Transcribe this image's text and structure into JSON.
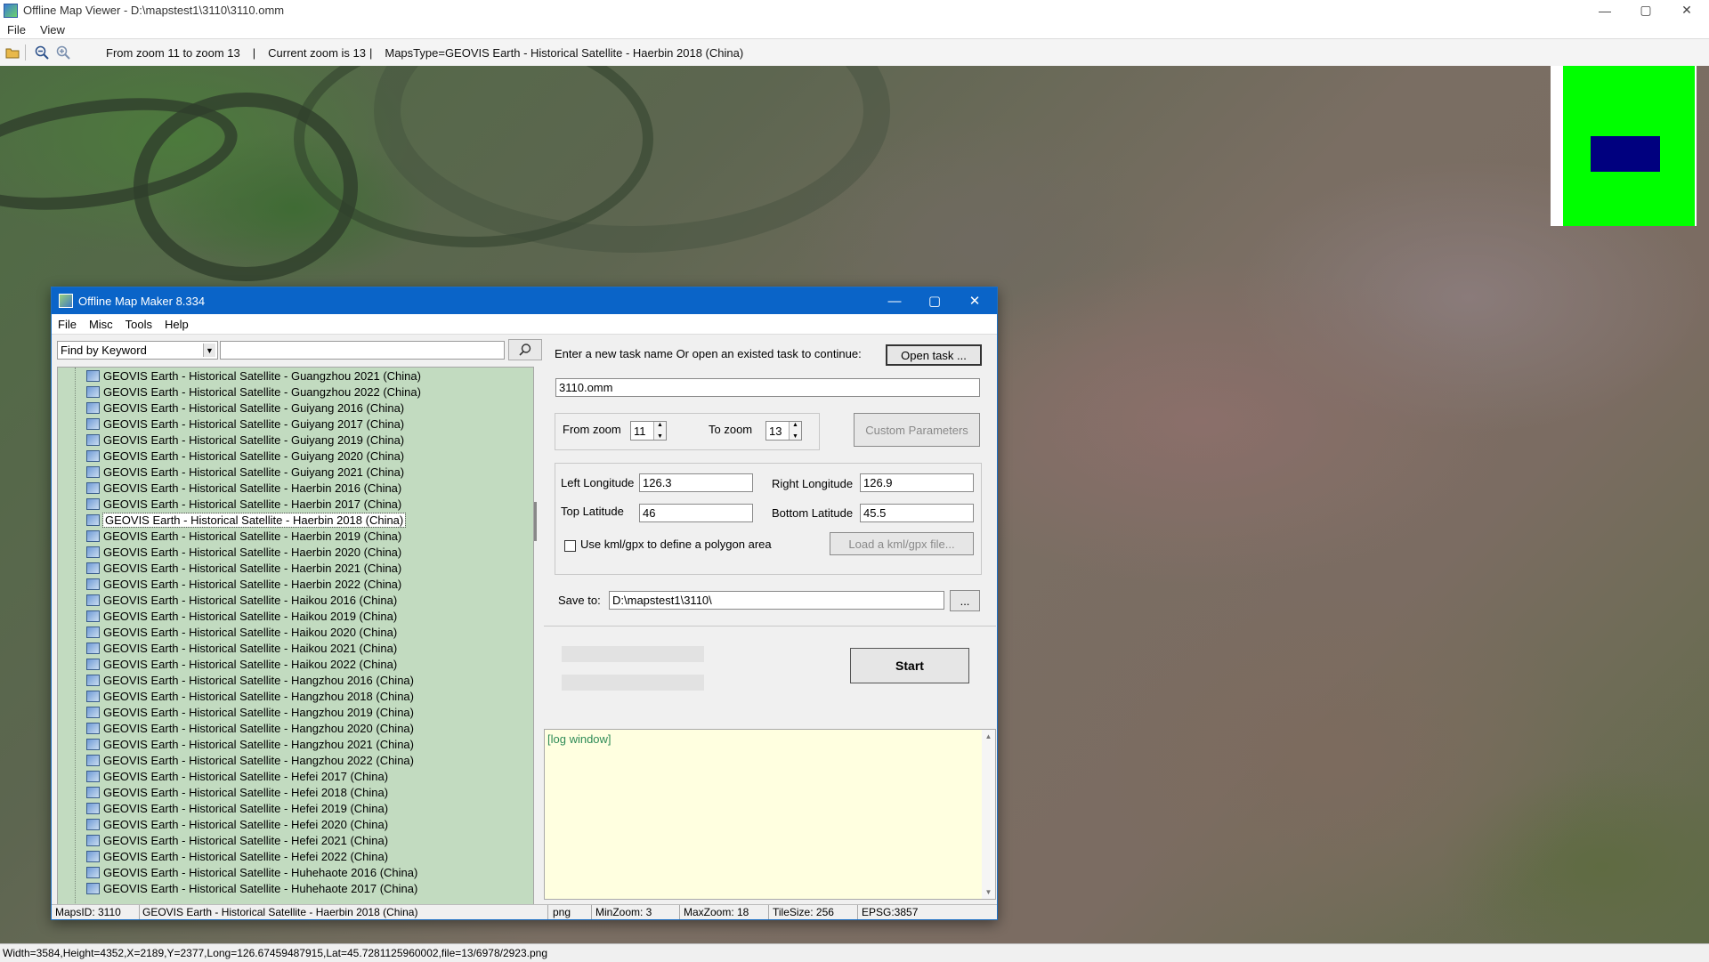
{
  "window": {
    "title": "Offline Map Viewer - D:\\mapstest1\\3110\\3110.omm",
    "minimize": "—",
    "maximize": "▢",
    "close": "✕"
  },
  "menu": {
    "file": "File",
    "view": "View"
  },
  "toolbar": {
    "zoom_range": "From zoom 11 to zoom 13",
    "current_zoom": "Current zoom is 13",
    "maps_type": "MapsType=GEOVIS Earth - Historical Satellite - Haerbin 2018 (China)",
    "sep": "|"
  },
  "status_bar": "Width=3584,Height=4352,X=2189,Y=2377,Long=126.67459487915,Lat=45.7281125960002,file=13/6978/2923.png",
  "minimap": {
    "bg_color": "#00ff00",
    "view_color": "#00007f"
  },
  "dialog": {
    "title": "Offline Map Maker 8.334",
    "menu": [
      "File",
      "Misc",
      "Tools",
      "Help"
    ],
    "find_mode": "Find by Keyword",
    "find_query": "",
    "list": [
      "GEOVIS Earth - Historical Satellite - Guangzhou 2021 (China)",
      "GEOVIS Earth - Historical Satellite - Guangzhou 2022 (China)",
      "GEOVIS Earth - Historical Satellite - Guiyang 2016 (China)",
      "GEOVIS Earth - Historical Satellite - Guiyang 2017 (China)",
      "GEOVIS Earth - Historical Satellite - Guiyang 2019 (China)",
      "GEOVIS Earth - Historical Satellite - Guiyang 2020 (China)",
      "GEOVIS Earth - Historical Satellite - Guiyang 2021 (China)",
      "GEOVIS Earth - Historical Satellite - Haerbin 2016 (China)",
      "GEOVIS Earth - Historical Satellite - Haerbin 2017 (China)",
      "GEOVIS Earth - Historical Satellite - Haerbin 2018 (China)",
      "GEOVIS Earth - Historical Satellite - Haerbin 2019 (China)",
      "GEOVIS Earth - Historical Satellite - Haerbin 2020 (China)",
      "GEOVIS Earth - Historical Satellite - Haerbin 2021 (China)",
      "GEOVIS Earth - Historical Satellite - Haerbin 2022 (China)",
      "GEOVIS Earth - Historical Satellite - Haikou 2016 (China)",
      "GEOVIS Earth - Historical Satellite - Haikou 2019 (China)",
      "GEOVIS Earth - Historical Satellite - Haikou 2020 (China)",
      "GEOVIS Earth - Historical Satellite - Haikou 2021 (China)",
      "GEOVIS Earth - Historical Satellite - Haikou 2022 (China)",
      "GEOVIS Earth - Historical Satellite - Hangzhou 2016 (China)",
      "GEOVIS Earth - Historical Satellite - Hangzhou 2018 (China)",
      "GEOVIS Earth - Historical Satellite - Hangzhou 2019 (China)",
      "GEOVIS Earth - Historical Satellite - Hangzhou 2020 (China)",
      "GEOVIS Earth - Historical Satellite - Hangzhou 2021 (China)",
      "GEOVIS Earth - Historical Satellite - Hangzhou 2022 (China)",
      "GEOVIS Earth - Historical Satellite - Hefei 2017 (China)",
      "GEOVIS Earth - Historical Satellite - Hefei 2018 (China)",
      "GEOVIS Earth - Historical Satellite - Hefei 2019 (China)",
      "GEOVIS Earth - Historical Satellite - Hefei 2020 (China)",
      "GEOVIS Earth - Historical Satellite - Hefei 2021 (China)",
      "GEOVIS Earth - Historical Satellite - Hefei 2022 (China)",
      "GEOVIS Earth - Historical Satellite - Huhehaote 2016 (China)",
      "GEOVIS Earth - Historical Satellite - Huhehaote 2017 (China)"
    ],
    "selected_item": "GEOVIS Earth - Historical Satellite - Haerbin 2018 (China)",
    "task_prompt": "Enter a new task name Or open an existed task to continue:",
    "open_task": "Open task ...",
    "task_name": "3110.omm",
    "from_zoom_label": "From zoom",
    "from_zoom": "11",
    "to_zoom_label": "To zoom",
    "to_zoom": "13",
    "custom_params": "Custom Parameters",
    "left_lon_label": "Left Longitude",
    "left_lon": "126.3",
    "right_lon_label": "Right Longitude",
    "right_lon": "126.9",
    "top_lat_label": "Top Latitude",
    "top_lat": "46",
    "bottom_lat_label": "Bottom Latitude",
    "bottom_lat": "45.5",
    "kml_checkbox": "Use kml/gpx to define a polygon area",
    "kml_checked": false,
    "load_kml": "Load a kml/gpx file...",
    "save_to_label": "Save to:",
    "save_to": "D:\\mapstest1\\3110\\",
    "browse": "...",
    "start": "Start",
    "log": "[log window]",
    "status": {
      "maps_id": "MapsID: 3110",
      "name": "GEOVIS Earth - Historical Satellite - Haerbin 2018 (China)",
      "format": "png",
      "min_zoom": "MinZoom: 3",
      "max_zoom": "MaxZoom: 18",
      "tile_size": "TileSize: 256",
      "epsg": "EPSG:3857"
    }
  }
}
